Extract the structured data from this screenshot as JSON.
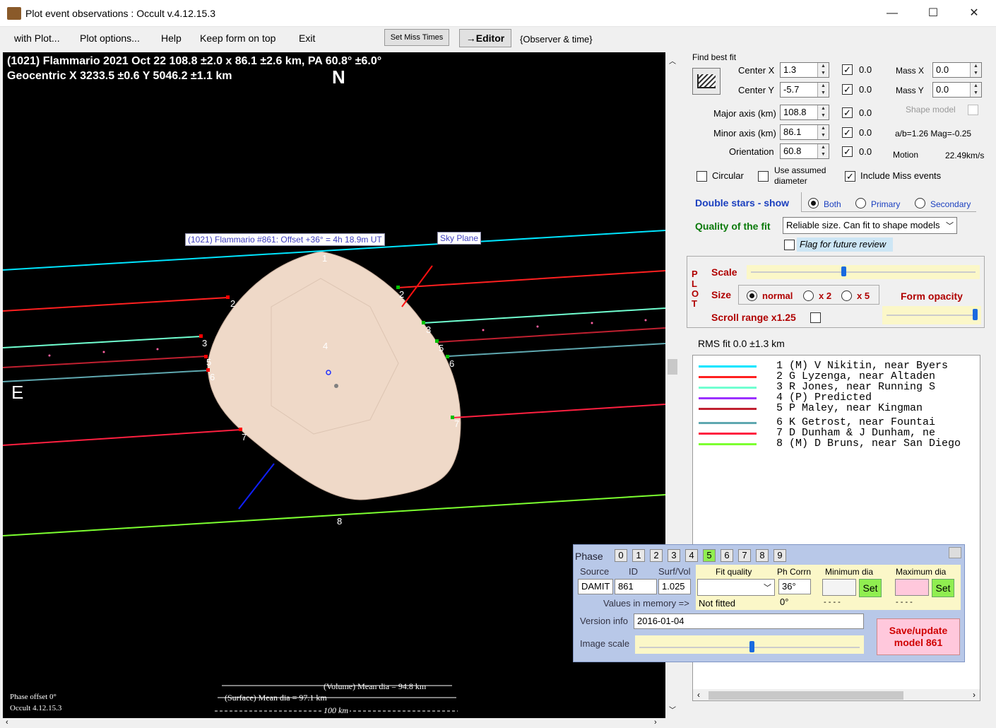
{
  "window": {
    "title": "Plot event observations : Occult v.4.12.15.3",
    "minimize": "—",
    "maximize": "☐",
    "close": "✕"
  },
  "menu": {
    "items": [
      "with Plot...",
      "Plot options...",
      "Help",
      "Keep form on top",
      "Exit"
    ],
    "set_miss_times": "Set Miss Times",
    "editor": "→Editor",
    "observer_time": "{Observer & time}"
  },
  "plot": {
    "header1": "(1021) Flammario  2021 Oct 22   108.8 ±2.0 x 86.1 ±2.6 km, PA 60.8° ±6.0°",
    "header2": "Geocentric  X  3233.5 ±0.6  Y 5046.2 ±1.1 km",
    "north": "N",
    "east": "E",
    "model_label": "(1021) Flammario #861: Offset +36° =  4h 18.9m UT",
    "sky_plane": "Sky Plane",
    "chord_numbers": [
      "1",
      "2",
      "3",
      "4",
      "5",
      "6",
      "7",
      "8"
    ],
    "volume_dia": "(Volume) Mean dia = 94.8 km",
    "surface_dia": "(Surface) Mean dia = 97.1 km",
    "scale_bar": "100 km",
    "phase_offset": "Phase offset 0°",
    "occult_version": "Occult 4.12.15.3"
  },
  "fit": {
    "title": "Find best fit",
    "center_x_label": "Center X",
    "center_x": "1.3",
    "center_y_label": "Center Y",
    "center_y": "-5.7",
    "major_label": "Major axis (km)",
    "major": "108.8",
    "minor_label": "Minor axis (km)",
    "minor": "86.1",
    "orient_label": "Orientation",
    "orient": "60.8",
    "check_vals": [
      "0.0",
      "0.0",
      "0.0",
      "0.0",
      "0.0"
    ],
    "mass_x_label": "Mass X",
    "mass_x": "0.0",
    "mass_y_label": "Mass Y",
    "mass_y": "0.0",
    "shape_model_label": "Shape model",
    "ab_ratio": "a/b=1.26  Mag=-0.25",
    "motion_label": "Motion",
    "motion_val": "22.49km/s",
    "circular_label": "Circular",
    "use_assumed_label": "Use assumed diameter",
    "include_miss_label": "Include Miss events"
  },
  "double": {
    "label": "Double stars - show",
    "both": "Both",
    "primary": "Primary",
    "secondary": "Secondary"
  },
  "quality": {
    "label": "Quality of the fit",
    "value": "Reliable size. Can fit to shape models",
    "flag_label": "Flag for future review"
  },
  "plotpanel": {
    "side": "PLOT",
    "scale_label": "Scale",
    "size_label": "Size",
    "normal": "normal",
    "x2": "x 2",
    "x5": "x 5",
    "form_opacity": "Form opacity",
    "scroll_range": "Scroll range x1.25"
  },
  "rms": "RMS fit 0.0 ±1.3 km",
  "legend": [
    {
      "color": "#00e5ff",
      "text": "1 (M)  V Nikitin, near Byers"
    },
    {
      "color": "#ff2020",
      "text": "2      G Lyzenga, near Altaden"
    },
    {
      "color": "#70ffd0",
      "text": "3      R Jones, near Running S"
    },
    {
      "color": "#9b30ff",
      "text": "4 (P)  Predicted"
    },
    {
      "color": "#c02030",
      "text": "5      P Maley, near Kingman"
    },
    {
      "color": "#5fa8b0",
      "text": "6      K Getrost, near Fountai"
    },
    {
      "color": "#ff2040",
      "text": "7      D Dunham & J Dunham, ne"
    },
    {
      "color": "#7cff30",
      "text": "8 (M)  D Bruns, near San Diego"
    }
  ],
  "shape": {
    "phase_label": "Phase",
    "phases": [
      "0",
      "1",
      "2",
      "3",
      "4",
      "5",
      "6",
      "7",
      "8",
      "9"
    ],
    "source_label": "Source",
    "id_label": "ID",
    "surfvol_label": "Surf/Vol",
    "source": "DAMIT",
    "id": "861",
    "surfvol": "1.025",
    "fitq_label": "Fit quality",
    "phcorr_label": "Ph Corrn",
    "mindia_label": "Minimum dia",
    "maxdia_label": "Maximum dia",
    "phcorr": "36°",
    "set": "Set",
    "values_mem": "Values in memory =>",
    "not_fitted": "Not fitted",
    "phcorr_mem": "0°",
    "min_mem": "- - - -",
    "max_mem": "- - - -",
    "version_label": "Version info",
    "version": "2016-01-04",
    "image_scale_label": "Image scale",
    "save_btn": "Save/update model 861"
  }
}
